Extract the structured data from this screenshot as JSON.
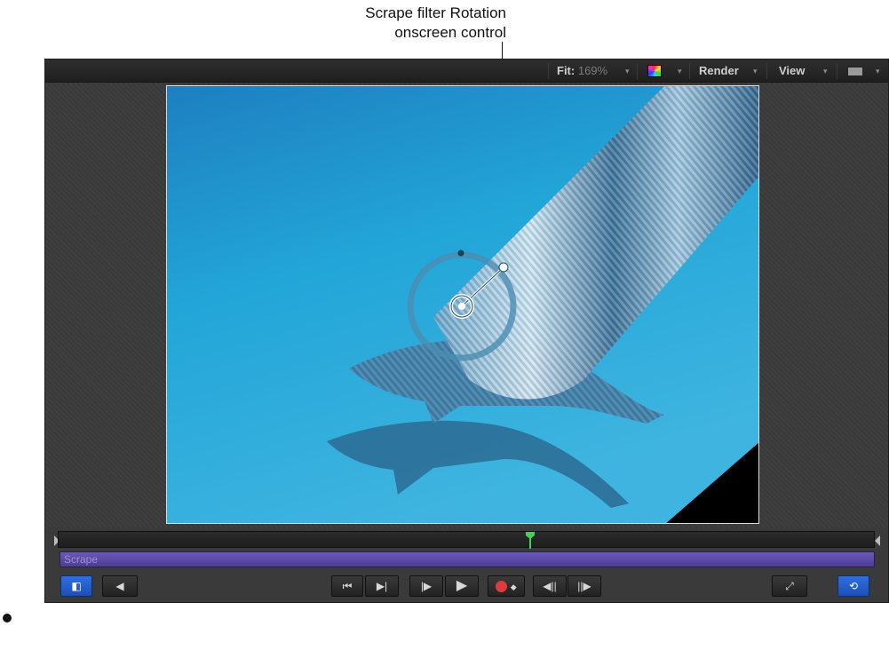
{
  "callout": {
    "line1": "Scrape filter Rotation",
    "line2": "onscreen control"
  },
  "toolbar": {
    "fit_label": "Fit:",
    "fit_value": "169%",
    "render_label": "Render",
    "view_label": "View",
    "dropdown_glyph": "▾"
  },
  "canvas": {
    "content": "dolphins-underwater-with-scrape-filter",
    "onscreen_control": "rotation-dial"
  },
  "timeline": {
    "track_label": "Scrape"
  },
  "transport": {
    "go_to_start": "⏮",
    "play_backward_frame": "▶|",
    "play_forward_frame": "|▶",
    "play": "▶",
    "step_back": "◀||",
    "step_forward": "||▶"
  },
  "colors": {
    "accent_blue": "#2f6fe0",
    "track_purple": "#5b4aa8",
    "playhead_green": "#44d15a",
    "record_red": "#e03b3b",
    "water_blue": "#1c9ad0"
  }
}
